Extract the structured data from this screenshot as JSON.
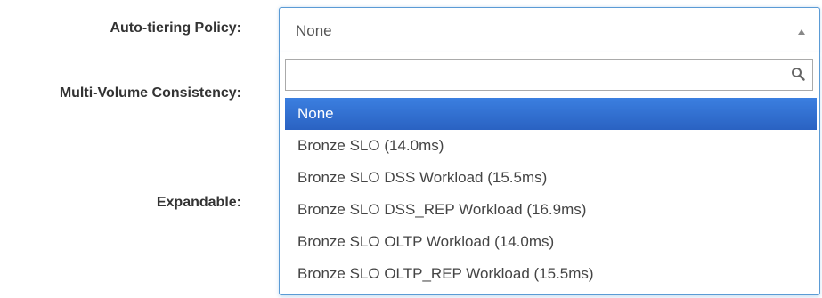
{
  "labels": {
    "auto_tiering": "Auto-tiering Policy:",
    "multi_volume": "Multi-Volume Consistency:",
    "expandable": "Expandable:"
  },
  "select": {
    "value": "None",
    "search_placeholder": "",
    "options": [
      {
        "label": "None",
        "selected": true
      },
      {
        "label": "Bronze SLO (14.0ms)",
        "selected": false
      },
      {
        "label": "Bronze SLO DSS Workload (15.5ms)",
        "selected": false
      },
      {
        "label": "Bronze SLO DSS_REP Workload (16.9ms)",
        "selected": false
      },
      {
        "label": "Bronze SLO OLTP Workload (14.0ms)",
        "selected": false
      },
      {
        "label": "Bronze SLO OLTP_REP Workload (15.5ms)",
        "selected": false
      }
    ]
  },
  "colors": {
    "focus_border": "#5b9bd5",
    "selected_bg": "#3875d7",
    "label_text": "#333333"
  },
  "icons": {
    "search": "search-icon",
    "arrow": "arrow-up-icon"
  }
}
